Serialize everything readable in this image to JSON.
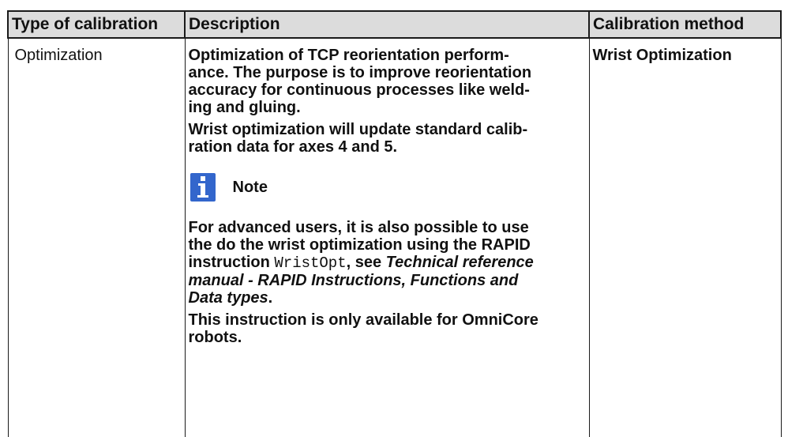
{
  "table": {
    "headers": [
      "Type of calibration",
      "Description",
      "Calibration method"
    ],
    "rows": [
      {
        "type": "Optimization",
        "method": "Wrist Optimization",
        "description": {
          "para1_lines": [
            "Optimization of TCP reorientation perform-",
            "ance. The purpose is to improve reorientation",
            "accuracy for continuous processes like weld-",
            "ing and gluing."
          ],
          "para2_lines": [
            "Wrist optimization will update standard calib-",
            "ration data for axes 4 and 5."
          ],
          "note": {
            "icon": "info-icon",
            "icon_color": "#3366cc",
            "label": "Note"
          },
          "para3": {
            "line1": "For advanced users, it is also possible to use",
            "line2": "the do the wrist optimization using the RAPID",
            "line3_prefix": "instruction ",
            "code": "WristOpt",
            "line3_mid": ", see ",
            "ref_line3": "Technical reference",
            "ref_line4": "manual - RAPID Instructions, Functions and",
            "ref_line5": "Data types",
            "end": "."
          },
          "para4_lines": [
            "This instruction is only available for OmniCore",
            "robots."
          ]
        }
      }
    ]
  },
  "colors": {
    "header_bg": "#dcdcdc",
    "border": "#1a1a1a"
  }
}
